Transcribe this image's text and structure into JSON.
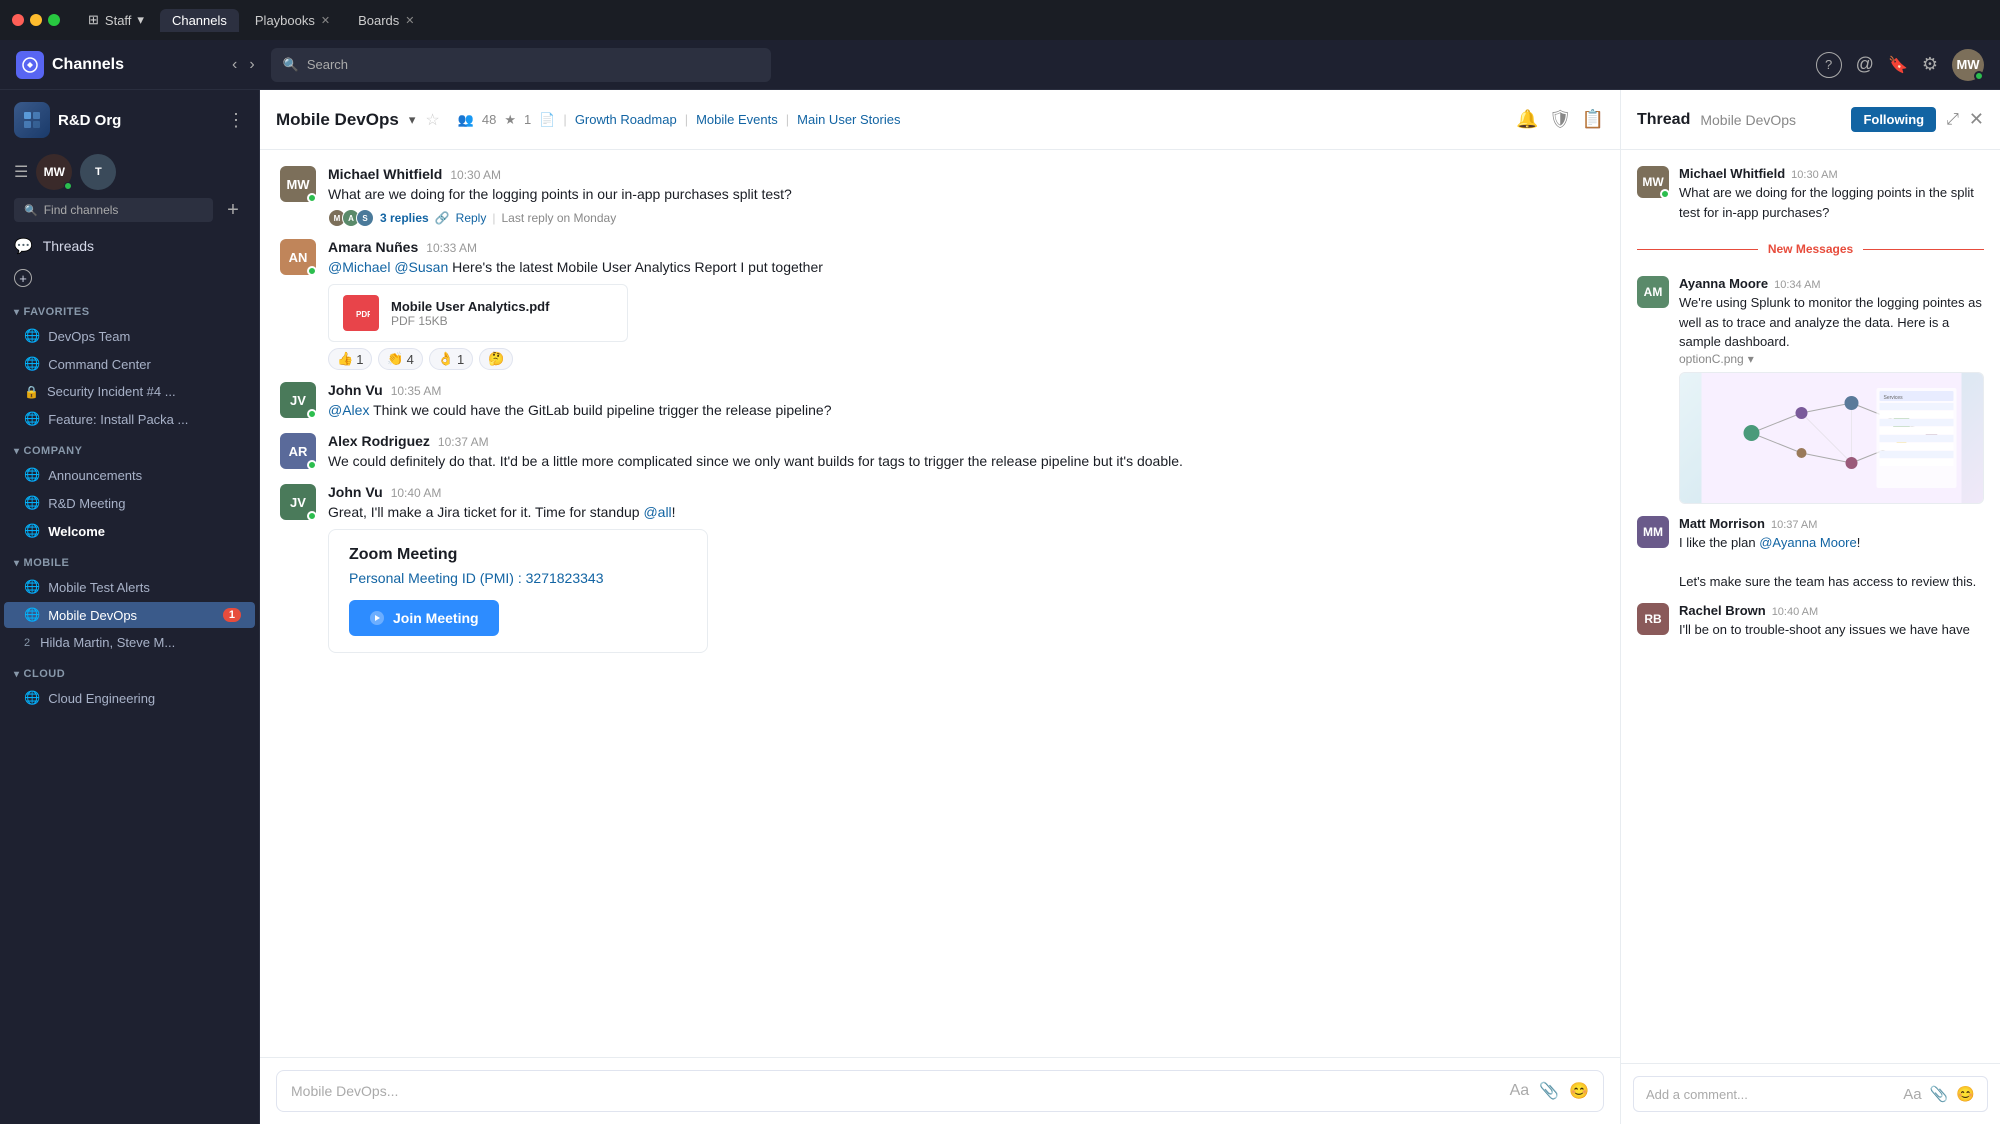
{
  "window": {
    "tabs": [
      {
        "label": "Staff",
        "active": false,
        "closable": false,
        "dropdown": true
      },
      {
        "label": "Channels",
        "active": true,
        "closable": false
      },
      {
        "label": "Playbooks",
        "active": false,
        "closable": true
      },
      {
        "label": "Boards",
        "active": false,
        "closable": true
      }
    ]
  },
  "topnav": {
    "workspace": "Channels",
    "search_placeholder": "Search",
    "help_icon": "?",
    "mention_icon": "@",
    "bookmark_icon": "🔖",
    "gear_icon": "⚙"
  },
  "sidebar": {
    "workspace_name": "R&D Org",
    "find_placeholder": "Find channels",
    "threads_label": "Threads",
    "new_label": "+",
    "favorites_label": "FAVORITES",
    "favorite_items": [
      {
        "label": "DevOps Team",
        "type": "globe",
        "active": false
      },
      {
        "label": "Command Center",
        "type": "globe",
        "active": false
      },
      {
        "label": "Security Incident #4 ...",
        "type": "lock",
        "active": false
      },
      {
        "label": "Feature: Install Packa ...",
        "type": "globe",
        "active": false
      }
    ],
    "company_label": "COMPANY",
    "company_items": [
      {
        "label": "Announcements",
        "type": "globe",
        "active": false
      },
      {
        "label": "R&D Meeting",
        "type": "globe",
        "active": false
      },
      {
        "label": "Welcome",
        "type": "globe",
        "active": false,
        "bold": true
      }
    ],
    "mobile_label": "MOBILE",
    "mobile_items": [
      {
        "label": "Mobile Test Alerts",
        "type": "globe",
        "active": false
      },
      {
        "label": "Mobile DevOps",
        "type": "globe",
        "active": true,
        "badge": "1"
      },
      {
        "label": "Hilda Martin, Steve M...",
        "type": "dm",
        "number": "2",
        "active": false
      }
    ],
    "cloud_label": "CLOUD",
    "cloud_items": [
      {
        "label": "Cloud Engineering",
        "type": "globe",
        "active": false
      }
    ]
  },
  "channel": {
    "name": "Mobile DevOps",
    "member_count": "48",
    "star_count": "1",
    "links": [
      "Growth Roadmap",
      "Mobile Events",
      "Main User Stories"
    ],
    "messages": [
      {
        "id": "msg1",
        "author": "Michael Whitfield",
        "time": "10:30 AM",
        "text": "What are we doing for the logging points in our in-app purchases split test?",
        "avatar_color": "#7c6f5a",
        "avatar_initials": "MW",
        "online": true,
        "replies": {
          "count": "3 replies",
          "action": "Reply",
          "last_reply": "Last reply on Monday"
        }
      },
      {
        "id": "msg2",
        "author": "Amara Nuñes",
        "time": "10:33 AM",
        "text": "@Michael @Susan Here's the latest Mobile User Analytics Report I put together",
        "avatar_color": "#c0855a",
        "avatar_initials": "AN",
        "online": true,
        "file": {
          "name": "Mobile User Analytics.pdf",
          "size": "PDF 15KB",
          "icon": "📄"
        },
        "reactions": [
          {
            "emoji": "👍",
            "count": "1"
          },
          {
            "emoji": "👏",
            "count": "4"
          },
          {
            "emoji": "👌",
            "count": "1"
          },
          {
            "emoji": "🤔",
            "count": ""
          }
        ]
      },
      {
        "id": "msg3",
        "author": "John Vu",
        "time": "10:35 AM",
        "text": "@Alex Think we could have the GitLab build pipeline trigger the release pipeline?",
        "avatar_color": "#4a7a5a",
        "avatar_initials": "JV",
        "online": true
      },
      {
        "id": "msg4",
        "author": "Alex Rodriguez",
        "time": "10:37 AM",
        "text": "We could definitely do that. It'd be a little more complicated since we only want builds for tags to trigger the release pipeline but it's doable.",
        "avatar_color": "#5a6a9a",
        "avatar_initials": "AR",
        "online": true
      },
      {
        "id": "msg5",
        "author": "John Vu",
        "time": "10:40 AM",
        "text": "Great, I'll make a Jira ticket for it. Time for standup @all!",
        "avatar_color": "#4a7a5a",
        "avatar_initials": "JV",
        "online": true,
        "zoom": {
          "title": "Zoom Meeting",
          "pmi_label": "Personal Meeting ID (PMI) :",
          "pmi_number": "3271823343",
          "join_label": "Join Meeting"
        }
      }
    ],
    "input_placeholder": "Mobile DevOps..."
  },
  "thread": {
    "title": "Thread",
    "channel": "Mobile DevOps",
    "following_label": "Following",
    "original_message": "What are we doing for the logging points in the split test for in-app purchases?",
    "original_author": "Michael Whitfield",
    "original_time": "10:30 AM",
    "original_avatar_color": "#7c6f5a",
    "new_messages_label": "New Messages",
    "replies": [
      {
        "author": "Ayanna Moore",
        "time": "10:34 AM",
        "text": "We're using Splunk to monitor the logging pointes as well as to trace and analyze the data. Here is a sample dashboard.",
        "avatar_color": "#5a8a6a",
        "avatar_initials": "AM",
        "has_image": true,
        "image_filename": "optionC.png"
      },
      {
        "author": "Matt Morrison",
        "time": "10:37 AM",
        "text": "I like the plan @Ayanna Moore!\n\nLet's make sure the team has access to review this.",
        "avatar_color": "#6a5a8a",
        "avatar_initials": "MM"
      },
      {
        "author": "Rachel Brown",
        "time": "10:40 AM",
        "text": "I'll be on to trouble-shoot any issues we have have",
        "avatar_color": "#8a5a5a",
        "avatar_initials": "RB"
      }
    ],
    "input_placeholder": "Add a comment..."
  }
}
